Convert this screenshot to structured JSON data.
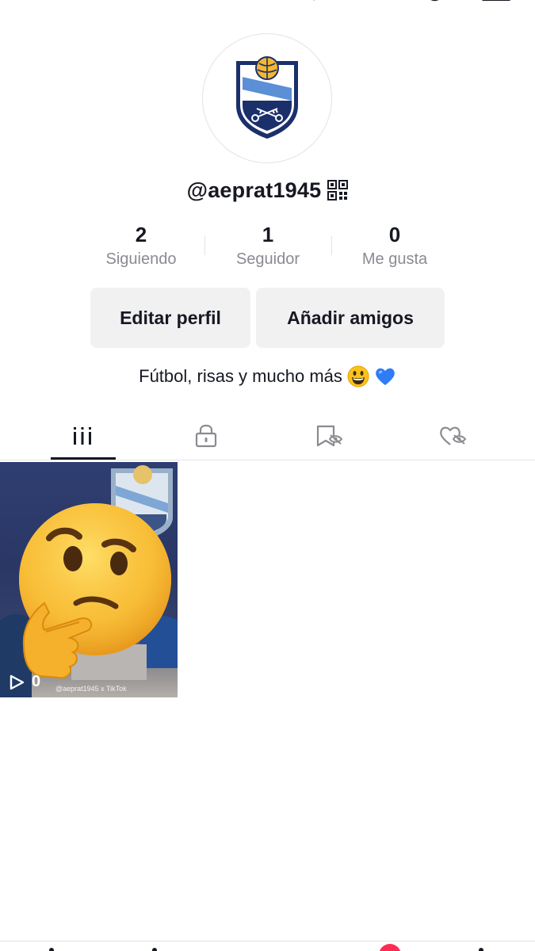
{
  "profile": {
    "username": "@aeprat1945",
    "bio_text": "Fútbol, risas y mucho más",
    "bio_emojis": [
      "grinning-face-emoji",
      "blue-heart-emoji"
    ]
  },
  "stats": [
    {
      "value": "2",
      "label": "Siguiendo"
    },
    {
      "value": "1",
      "label": "Seguidor"
    },
    {
      "value": "0",
      "label": "Me gusta"
    }
  ],
  "buttons": {
    "edit_profile": "Editar perfil",
    "add_friends": "Añadir amigos"
  },
  "tabs": [
    {
      "icon": "grid-icon",
      "active": true
    },
    {
      "icon": "lock-icon",
      "active": false
    },
    {
      "icon": "saved-hidden-icon",
      "active": false
    },
    {
      "icon": "liked-hidden-icon",
      "active": false
    }
  ],
  "videos": [
    {
      "views": "0",
      "watermark": "@aeprat1945 x TikTok",
      "overlay": "thinking-face-emoji"
    }
  ],
  "colors": {
    "text": "#161823",
    "secondary_text": "#8a8b91",
    "button_bg": "#f1f1f2",
    "crest_navy": "#1b2f6b",
    "crest_light_blue": "#5b8fd6",
    "badge_red": "#fe2c55"
  }
}
